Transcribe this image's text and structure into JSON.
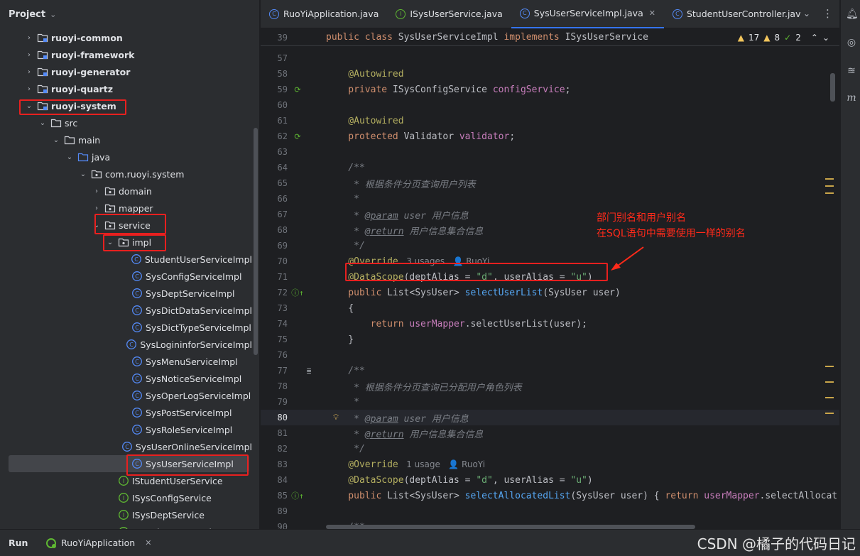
{
  "project": {
    "title": "Project",
    "tree": [
      {
        "label": "ruoyi-common",
        "icon": "module-folder-icon",
        "depth": 0,
        "arrow": "›",
        "bold": true
      },
      {
        "label": "ruoyi-framework",
        "icon": "module-folder-icon",
        "depth": 0,
        "arrow": "›",
        "bold": true
      },
      {
        "label": "ruoyi-generator",
        "icon": "module-folder-icon",
        "depth": 0,
        "arrow": "›",
        "bold": true
      },
      {
        "label": "ruoyi-quartz",
        "icon": "module-folder-icon",
        "depth": 0,
        "arrow": "›",
        "bold": true
      },
      {
        "label": "ruoyi-system",
        "icon": "module-folder-icon",
        "depth": 0,
        "arrow": "⌄",
        "bold": true
      },
      {
        "label": "src",
        "icon": "folder-icon",
        "depth": 1,
        "arrow": "⌄"
      },
      {
        "label": "main",
        "icon": "folder-icon",
        "depth": 2,
        "arrow": "⌄"
      },
      {
        "label": "java",
        "icon": "source-folder-icon",
        "depth": 3,
        "arrow": "⌄"
      },
      {
        "label": "com.ruoyi.system",
        "icon": "package-icon",
        "depth": 4,
        "arrow": "⌄"
      },
      {
        "label": "domain",
        "icon": "package-icon",
        "depth": 5,
        "arrow": "›"
      },
      {
        "label": "mapper",
        "icon": "package-icon",
        "depth": 5,
        "arrow": "›"
      },
      {
        "label": "service",
        "icon": "package-icon",
        "depth": 5,
        "arrow": "⌄"
      },
      {
        "label": "impl",
        "icon": "package-icon",
        "depth": 6,
        "arrow": "⌄"
      },
      {
        "label": "StudentUserServiceImpl",
        "icon": "class-icon",
        "depth": 7
      },
      {
        "label": "SysConfigServiceImpl",
        "icon": "class-icon",
        "depth": 7
      },
      {
        "label": "SysDeptServiceImpl",
        "icon": "class-icon",
        "depth": 7
      },
      {
        "label": "SysDictDataServiceImpl",
        "icon": "class-icon",
        "depth": 7
      },
      {
        "label": "SysDictTypeServiceImpl",
        "icon": "class-icon",
        "depth": 7
      },
      {
        "label": "SysLogininforServiceImpl",
        "icon": "class-icon",
        "depth": 7
      },
      {
        "label": "SysMenuServiceImpl",
        "icon": "class-icon",
        "depth": 7
      },
      {
        "label": "SysNoticeServiceImpl",
        "icon": "class-icon",
        "depth": 7
      },
      {
        "label": "SysOperLogServiceImpl",
        "icon": "class-icon",
        "depth": 7
      },
      {
        "label": "SysPostServiceImpl",
        "icon": "class-icon",
        "depth": 7
      },
      {
        "label": "SysRoleServiceImpl",
        "icon": "class-icon",
        "depth": 7
      },
      {
        "label": "SysUserOnlineServiceImpl",
        "icon": "class-icon",
        "depth": 7
      },
      {
        "label": "SysUserServiceImpl",
        "icon": "class-icon",
        "depth": 7,
        "selected": true
      },
      {
        "label": "IStudentUserService",
        "icon": "interface-icon",
        "depth": 6
      },
      {
        "label": "ISysConfigService",
        "icon": "interface-icon",
        "depth": 6
      },
      {
        "label": "ISysDeptService",
        "icon": "interface-icon",
        "depth": 6
      },
      {
        "label": "ISysDictDataService",
        "icon": "interface-icon",
        "depth": 6
      }
    ]
  },
  "tabs": [
    {
      "label": "RuoYiApplication.java",
      "icon": "class-icon"
    },
    {
      "label": "ISysUserService.java",
      "icon": "interface-icon"
    },
    {
      "label": "SysUserServiceImpl.java",
      "icon": "class-icon",
      "active": true,
      "closable": true
    },
    {
      "label": "StudentUserController.jav",
      "icon": "class-icon"
    }
  ],
  "inspections": {
    "warnings": "17",
    "weak_warnings": "8",
    "typos": "2"
  },
  "sticky": {
    "number": "39",
    "code": [
      [
        "kw",
        "public class "
      ],
      [
        "",
        "SysUserServiceImpl "
      ],
      [
        "kw",
        "implements "
      ],
      [
        "",
        "ISysUserService"
      ]
    ]
  },
  "lines": [
    {
      "n": "57",
      "code": []
    },
    {
      "n": "58",
      "code": [
        [
          "an",
          "    @Autowired"
        ]
      ]
    },
    {
      "n": "59",
      "gutter": "bean-icon",
      "code": [
        [
          "kw",
          "    private "
        ],
        [
          "",
          "ISysConfigService "
        ],
        [
          "fld",
          "configService"
        ],
        [
          "",
          ";"
        ]
      ]
    },
    {
      "n": "60",
      "code": []
    },
    {
      "n": "61",
      "code": [
        [
          "an",
          "    @Autowired"
        ]
      ]
    },
    {
      "n": "62",
      "gutter": "bean-icon",
      "code": [
        [
          "kw",
          "    protected "
        ],
        [
          "",
          "Validator "
        ],
        [
          "fld",
          "validator"
        ],
        [
          "",
          ";"
        ]
      ]
    },
    {
      "n": "63",
      "code": []
    },
    {
      "n": "64",
      "code": [
        [
          "cmt",
          "    /**"
        ]
      ]
    },
    {
      "n": "65",
      "code": [
        [
          "cmt",
          "     * 根据条件分页查询用户列表"
        ]
      ]
    },
    {
      "n": "66",
      "code": [
        [
          "cmt",
          "     *"
        ]
      ]
    },
    {
      "n": "67",
      "code": [
        [
          "cmt",
          "     * "
        ],
        [
          "doctag",
          "@param"
        ],
        [
          "cmt",
          " user 用户信息"
        ]
      ]
    },
    {
      "n": "68",
      "code": [
        [
          "cmt",
          "     * "
        ],
        [
          "doctag",
          "@return"
        ],
        [
          "cmt",
          " 用户信息集合信息"
        ]
      ]
    },
    {
      "n": "69",
      "code": [
        [
          "cmt",
          "     */"
        ]
      ]
    },
    {
      "n": "70",
      "code": [
        [
          "an",
          "    @Override"
        ],
        [
          "hint",
          "   3 usages   👤 RuoYi"
        ]
      ]
    },
    {
      "n": "71",
      "code": [
        [
          "an",
          "    @DataScope"
        ],
        [
          "",
          "(deptAlias = "
        ],
        [
          "str",
          "\"d\""
        ],
        [
          "",
          ", userAlias = "
        ],
        [
          "str",
          "\"u\""
        ],
        [
          "",
          ")"
        ]
      ]
    },
    {
      "n": "72",
      "gutter": "implements-icon",
      "code": [
        [
          "kw",
          "    public "
        ],
        [
          "",
          "List<SysUser> "
        ],
        [
          "fn",
          "selectUserList"
        ],
        [
          "",
          "(SysUser user)"
        ]
      ]
    },
    {
      "n": "73",
      "code": [
        [
          "",
          "    {"
        ]
      ]
    },
    {
      "n": "74",
      "code": [
        [
          "kw",
          "        return "
        ],
        [
          "fld",
          "userMapper"
        ],
        [
          "",
          ".selectUserList(user);"
        ]
      ]
    },
    {
      "n": "75",
      "code": [
        [
          "",
          "    }"
        ]
      ]
    },
    {
      "n": "76",
      "code": []
    },
    {
      "n": "77",
      "gutter": "doc-icon",
      "code": [
        [
          "cmt",
          "    /**"
        ]
      ]
    },
    {
      "n": "78",
      "code": [
        [
          "cmt",
          "     * 根据条件分页查询已分配用户角色列表"
        ]
      ]
    },
    {
      "n": "79",
      "code": [
        [
          "cmt",
          "     *"
        ]
      ]
    },
    {
      "n": "80",
      "current": true,
      "bulb": true,
      "code": [
        [
          "cmt",
          "     * "
        ],
        [
          "doctag",
          "@param"
        ],
        [
          "cmt",
          " user 用户信息"
        ]
      ]
    },
    {
      "n": "81",
      "code": [
        [
          "cmt",
          "     * "
        ],
        [
          "doctag",
          "@return"
        ],
        [
          "cmt",
          " 用户信息集合信息"
        ]
      ]
    },
    {
      "n": "82",
      "code": [
        [
          "cmt",
          "     */"
        ]
      ]
    },
    {
      "n": "83",
      "code": [
        [
          "an",
          "    @Override"
        ],
        [
          "hint",
          "   1 usage   👤 RuoYi"
        ]
      ]
    },
    {
      "n": "84",
      "code": [
        [
          "an",
          "    @DataScope"
        ],
        [
          "",
          "(deptAlias = "
        ],
        [
          "str",
          "\"d\""
        ],
        [
          "",
          ", userAlias = "
        ],
        [
          "str",
          "\"u\""
        ],
        [
          "",
          ")"
        ]
      ]
    },
    {
      "n": "85",
      "gutter": "implements-icon",
      "code": [
        [
          "kw",
          "    public "
        ],
        [
          "",
          "List<SysUser> "
        ],
        [
          "fn",
          "selectAllocatedList"
        ],
        [
          "",
          "(SysUser user) { "
        ],
        [
          "kw",
          "return "
        ],
        [
          "fld",
          "userMapper"
        ],
        [
          "",
          ".selectAllocat"
        ]
      ]
    },
    {
      "n": "89",
      "code": []
    },
    {
      "n": "90",
      "code": [
        [
          "cmt",
          "    /**"
        ]
      ]
    }
  ],
  "annotation": {
    "line1": "部门别名和用户别名",
    "line2": "在SQL语句中需要使用一样的别名"
  },
  "bottom": {
    "run_label": "Run",
    "run_config": "RuoYiApplication"
  },
  "watermark": "CSDN @橘子的代码日记",
  "colors": {
    "red_box": "#e8201f",
    "annotation": "#ff2a1a",
    "accent": "#3574f0"
  }
}
